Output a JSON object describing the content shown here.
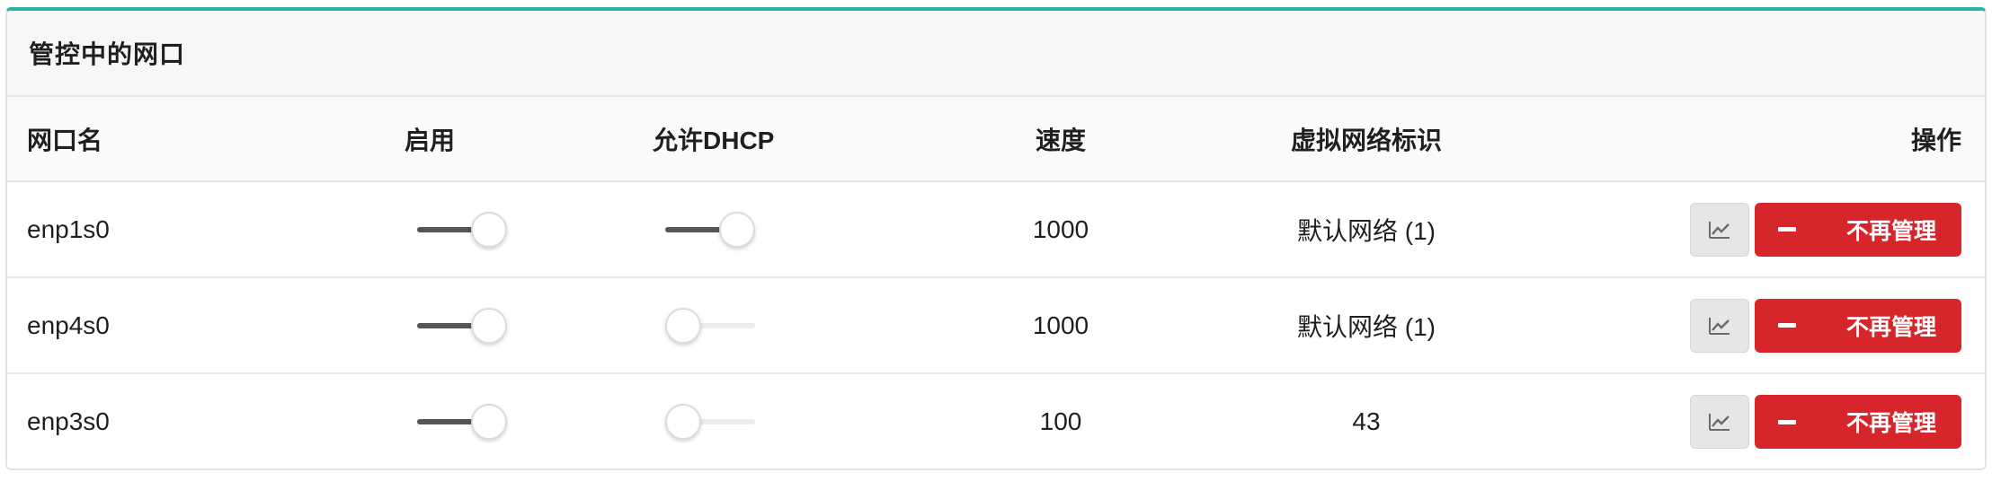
{
  "panel": {
    "title": "管控中的网口"
  },
  "table": {
    "headers": {
      "name": "网口名",
      "enable": "启用",
      "dhcp": "允许DHCP",
      "speed": "速度",
      "network": "虚拟网络标识",
      "ops": "操作"
    },
    "rows": [
      {
        "name": "enp1s0",
        "enabled": true,
        "dhcp": true,
        "speed": "1000",
        "network": "默认网络 (1)"
      },
      {
        "name": "enp4s0",
        "enabled": true,
        "dhcp": false,
        "speed": "1000",
        "network": "默认网络 (1)"
      },
      {
        "name": "enp3s0",
        "enabled": true,
        "dhcp": false,
        "speed": "100",
        "network": "43"
      }
    ],
    "actions": {
      "unmanage_label": "不再管理",
      "chart_icon": "chart-line-icon",
      "minus_icon": "minus-icon"
    }
  },
  "colors": {
    "accent_top": "#2fb3a7",
    "danger": "#d6252b",
    "switch_on": "#555555"
  }
}
